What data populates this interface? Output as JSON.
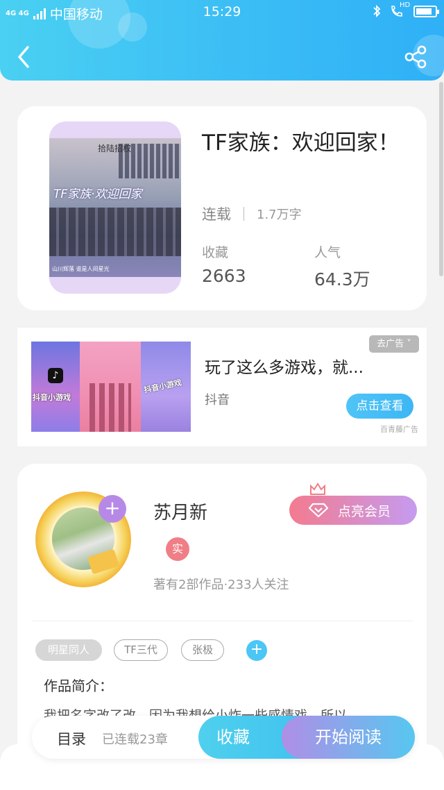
{
  "status_bar": {
    "network": "4G 4G",
    "carrier": "中国移动",
    "time": "15:29",
    "hd": "HD"
  },
  "header": {
    "back_icon": "chevron-left-icon",
    "share_icon": "share-icon"
  },
  "book": {
    "title": "TF家族：欢迎回家！",
    "status": "连载",
    "word_count": "1.7万字",
    "favorites_label": "收藏",
    "favorites_value": "2663",
    "popularity_label": "人气",
    "popularity_value": "64.3万",
    "cover": {
      "top_text": "拾陆招权",
      "title_text": "TF家族·欢迎回家",
      "bottom_text": "山川辉落 谁是人间星光"
    }
  },
  "ad": {
    "headline": "玩了这么多游戏，就...",
    "source": "抖音",
    "close_label": "去广告 ˅",
    "cta_label": "点击查看",
    "provider": "百青藤广告",
    "image_labels": [
      "抖音小游戏",
      "抖音小游戏"
    ]
  },
  "author": {
    "name": "苏月新",
    "verified_badge": "实",
    "meta": "著有2部作品·233人关注",
    "follow_symbol": "+",
    "vip_label": "点亮会员",
    "tags": [
      "明星同人",
      "TF三代",
      "张极"
    ],
    "tag_add_symbol": "+",
    "intro_label": "作品简介：",
    "intro_text": "我把名字改了改，因为我想给小炸一些感情戏，所以"
  },
  "bottom_bar": {
    "toc_label": "目录",
    "toc_count": "已连载23章",
    "collect_label": "收藏",
    "read_label": "开始阅读"
  },
  "colors": {
    "header_gradient_start": "#4ad0f2",
    "header_gradient_end": "#2fb0f7",
    "accent_blue": "#3ec0f0",
    "accent_purple": "#b08ee6",
    "vip_pink": "#f37b8f",
    "verified_red": "#f07e86"
  }
}
